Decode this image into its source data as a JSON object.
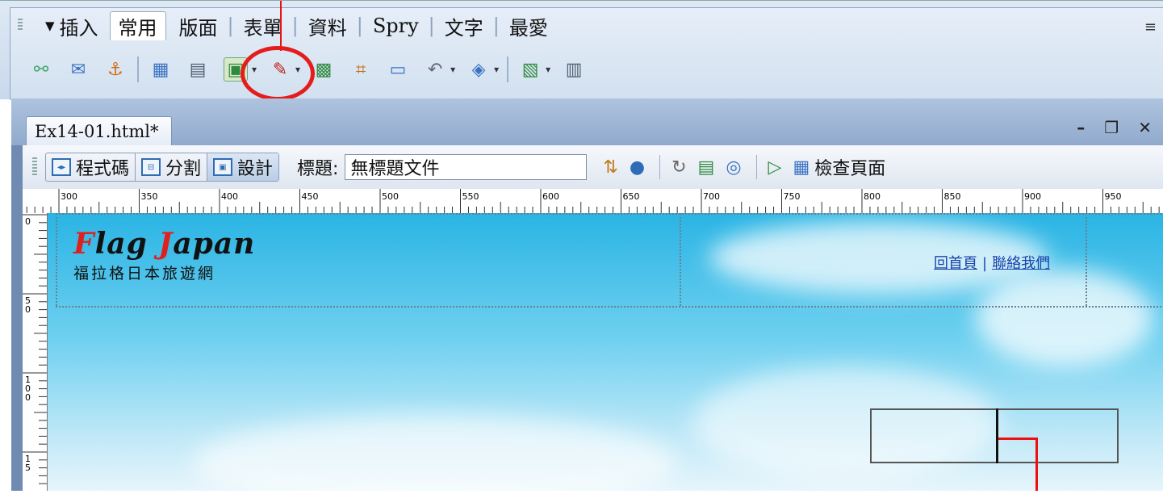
{
  "insert_panel": {
    "label": "插入",
    "tabs": [
      "常用",
      "版面",
      "表單",
      "資料",
      "Spry",
      "文字",
      "最愛"
    ],
    "active_tab": "常用",
    "menu_icon": "≡"
  },
  "document": {
    "filename": "Ex14-01.html*",
    "views": [
      "程式碼",
      "分割",
      "設計"
    ],
    "active_view": "設計",
    "title_label": "標題:",
    "title_value": "無標題文件",
    "check_page_label": "檢查頁面",
    "ruler_marks": [
      "300",
      "350",
      "400",
      "450",
      "500",
      "550",
      "600",
      "650",
      "700",
      "750",
      "800",
      "850",
      "900",
      "950"
    ],
    "vertical_ruler": [
      "0",
      "5\n0",
      "1\n0\n0",
      "1\n5"
    ]
  },
  "page": {
    "logo_main_first": "F",
    "logo_main_rest1": "lag ",
    "logo_main_j": "J",
    "logo_main_rest2": "apan",
    "logo_sub": "福拉格日本旅遊網",
    "nav_home": "回首頁",
    "nav_separator": "|",
    "nav_contact": "聯絡我們"
  },
  "colors": {
    "logo_accent": "#e0201c",
    "highlight": "#e51c1c",
    "link": "#1a43a8"
  }
}
